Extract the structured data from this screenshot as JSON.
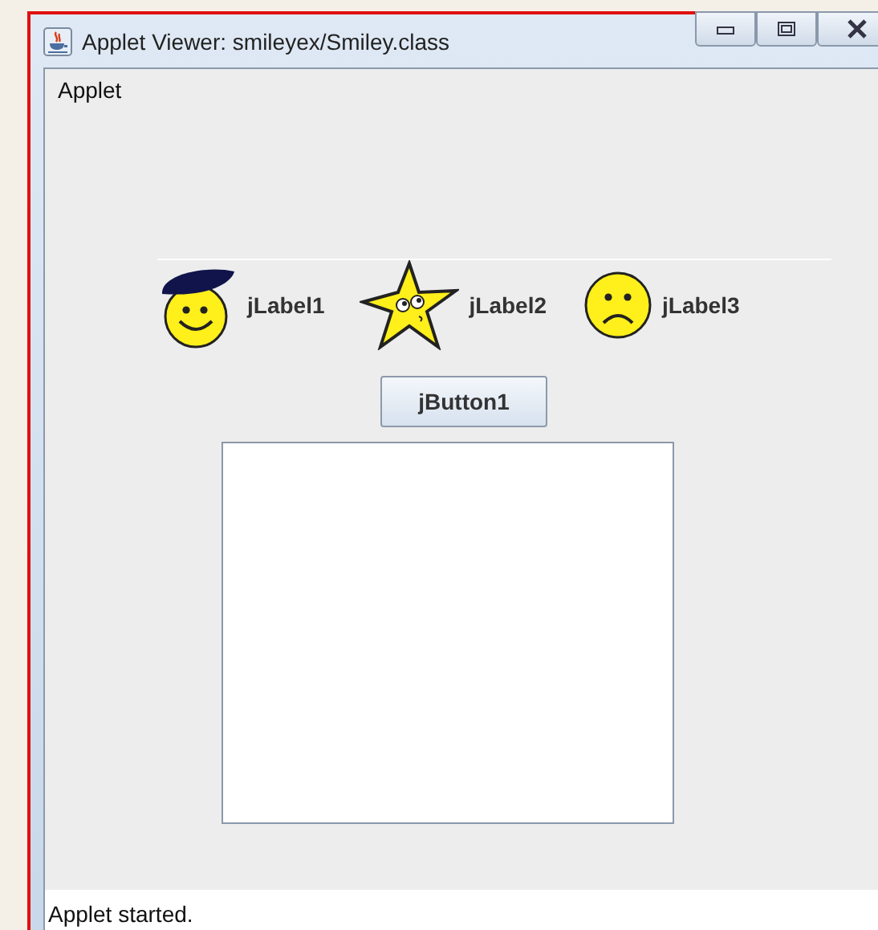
{
  "window": {
    "title": "Applet Viewer: smileyex/Smiley.class"
  },
  "menu": [
    "Applet"
  ],
  "labels": [
    {
      "kind": "beret",
      "text": "jLabel1"
    },
    {
      "kind": "star",
      "text": "jLabel2"
    },
    {
      "kind": "frown",
      "text": "jLabel3"
    }
  ],
  "button": "jButton1",
  "status_bar": "Applet started."
}
